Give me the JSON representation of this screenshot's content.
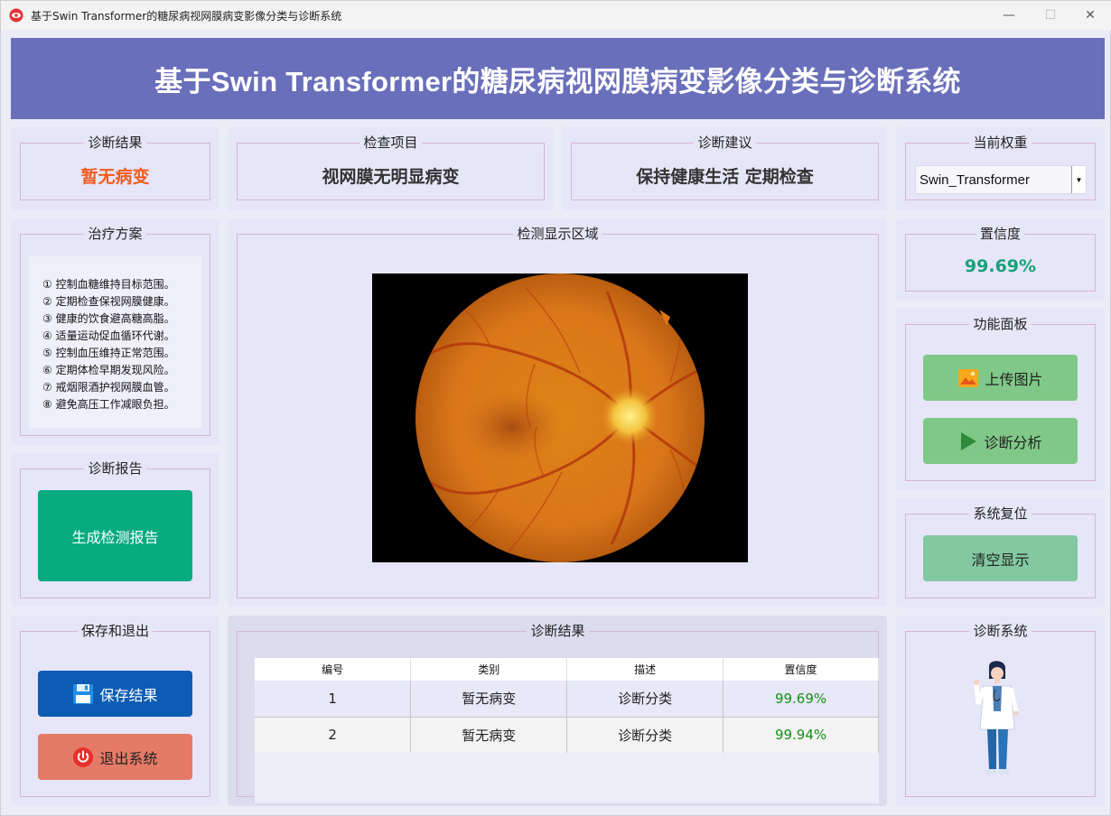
{
  "window": {
    "title": "基于Swin Transformer的糖尿病视网膜病变影像分类与诊断系统"
  },
  "banner": {
    "title": "基于Swin Transformer的糖尿病视网膜病变影像分类与诊断系统"
  },
  "diagnosis_result": {
    "label": "诊断结果",
    "value": "暂无病变"
  },
  "exam_item": {
    "label": "检查项目",
    "value": "视网膜无明显病变"
  },
  "advice": {
    "label": "诊断建议",
    "value": "保持健康生活 定期检查"
  },
  "weights": {
    "label": "当前权重",
    "selected": "Swin_Transformer"
  },
  "treatment": {
    "label": "治疗方案",
    "items": [
      "① 控制血糖维持目标范围。",
      "② 定期检查保视网膜健康。",
      "③ 健康的饮食避高糖高脂。",
      "④ 适量运动促血循环代谢。",
      "⑤ 控制血压维持正常范围。",
      "⑥ 定期体检早期发现风险。",
      "⑦ 戒烟限酒护视网膜血管。",
      "⑧ 避免高压工作减眼负担。"
    ]
  },
  "display": {
    "label": "检测显示区域"
  },
  "confidence": {
    "label": "置信度",
    "value": "99.69%"
  },
  "functions": {
    "label": "功能面板",
    "upload": "上传图片",
    "analyze": "诊断分析"
  },
  "reset": {
    "label": "系统复位",
    "clear": "清空显示"
  },
  "report": {
    "label": "诊断报告",
    "generate": "生成检测报告"
  },
  "save_exit": {
    "label": "保存和退出",
    "save": "保存结果",
    "exit": "退出系统"
  },
  "results_table": {
    "label": "诊断结果",
    "columns": [
      "编号",
      "类别",
      "描述",
      "置信度"
    ],
    "rows": [
      [
        "1",
        "暂无病变",
        "诊断分类",
        "99.69%"
      ],
      [
        "2",
        "暂无病变",
        "诊断分类",
        "99.94%"
      ]
    ]
  },
  "system": {
    "label": "诊断系统"
  },
  "colors": {
    "banner": "#6a6fbb",
    "accent_orange": "#f25c1e",
    "confidence_green": "#19a27b",
    "teal_button": "#06ab80",
    "save_button": "#0c5cb4",
    "exit_button": "#e57a67"
  }
}
